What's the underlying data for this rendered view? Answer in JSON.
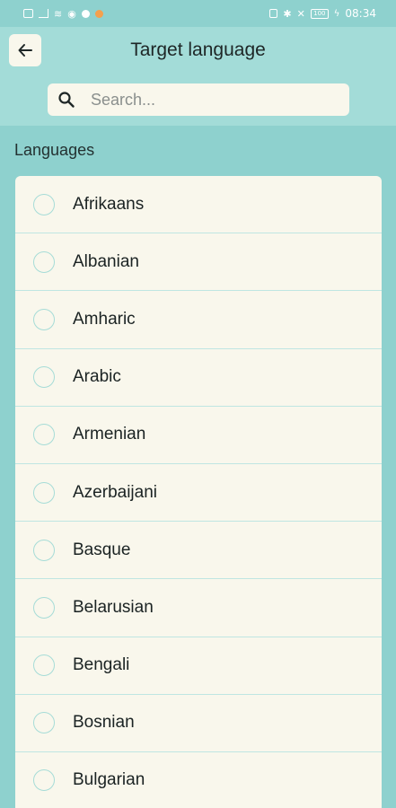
{
  "status_bar": {
    "time": "08:34",
    "battery": "100",
    "left_icons": [
      "gallery-icon",
      "signal-icon",
      "wifi-icon",
      "eye-icon",
      "chat-icon",
      "notification-dot-icon"
    ],
    "right_icons": [
      "nfc-icon",
      "bluetooth-icon",
      "mute-icon",
      "battery-icon",
      "charging-icon"
    ]
  },
  "header": {
    "title": "Target language",
    "back_icon": "arrow-left-icon"
  },
  "search": {
    "placeholder": "Search...",
    "value": "",
    "icon": "search-icon"
  },
  "section": {
    "title": "Languages"
  },
  "languages": [
    {
      "label": "Afrikaans",
      "selected": false
    },
    {
      "label": "Albanian",
      "selected": false
    },
    {
      "label": "Amharic",
      "selected": false
    },
    {
      "label": "Arabic",
      "selected": false
    },
    {
      "label": "Armenian",
      "selected": false
    },
    {
      "label": "Azerbaijani",
      "selected": false
    },
    {
      "label": "Basque",
      "selected": false
    },
    {
      "label": "Belarusian",
      "selected": false
    },
    {
      "label": "Bengali",
      "selected": false
    },
    {
      "label": "Bosnian",
      "selected": false
    },
    {
      "label": "Bulgarian",
      "selected": false
    }
  ],
  "colors": {
    "background": "#8ed1ce",
    "header": "#a3dcd8",
    "card": "#f9f7ec",
    "radio_border": "#a6dcd7"
  }
}
